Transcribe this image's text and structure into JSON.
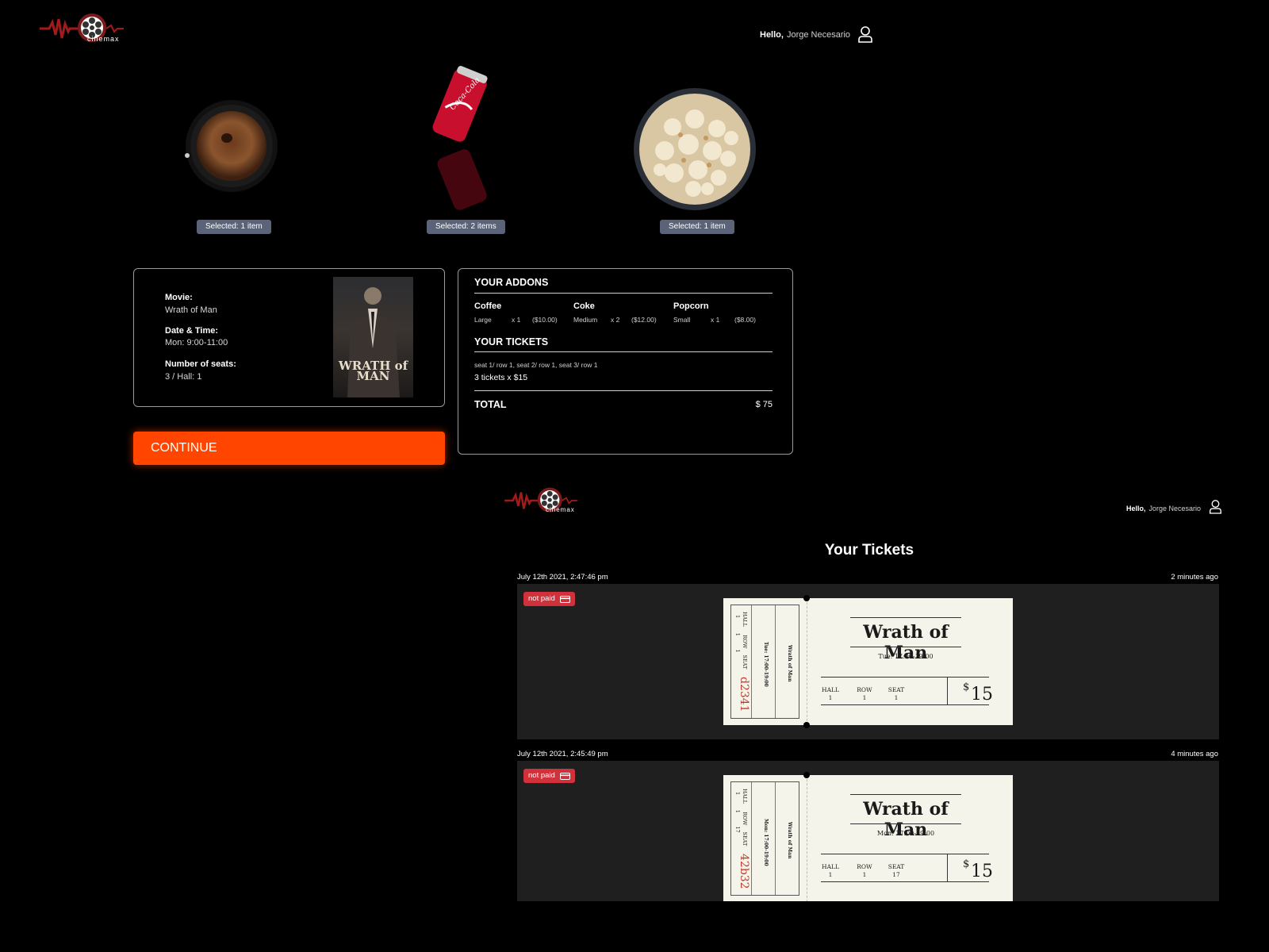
{
  "header": {
    "brand": "cinemax",
    "greeting": "Hello,",
    "user_name": "Jorge Necesario"
  },
  "addons_selection": [
    {
      "name": "Coffee",
      "icon": "coffee-cup-icon",
      "selected": "Selected: 1 item"
    },
    {
      "name": "Coke",
      "icon": "coke-can-icon",
      "selected": "Selected: 2 items"
    },
    {
      "name": "Popcorn",
      "icon": "popcorn-bowl-icon",
      "selected": "Selected: 1 item"
    }
  ],
  "booking": {
    "movie_label": "Movie:",
    "movie_value": "Wrath of Man",
    "datetime_label": "Date & Time:",
    "datetime_value": "Mon: 9:00-11:00",
    "seats_label": "Number of seats:",
    "seats_value": "3 / Hall: 1",
    "poster_title": "WRATH of MAN"
  },
  "continue_label": "CONTINUE",
  "summary": {
    "addons_heading": "YOUR ADDONS",
    "addons": [
      {
        "name": "Coffee",
        "size": "Large",
        "qty": "x 1",
        "price": "($10.00)"
      },
      {
        "name": "Coke",
        "size": "Medium",
        "qty": "x 2",
        "price": "($12.00)"
      },
      {
        "name": "Popcorn",
        "size": "Small",
        "qty": "x 1",
        "price": "($8.00)"
      }
    ],
    "tickets_heading": "YOUR TICKETS",
    "seats_line": "seat 1/ row 1, seat 2/ row 1, seat 3/ row 1",
    "tickets_line": "3 tickets x $15",
    "total_label": "TOTAL",
    "total_value": "$ 75"
  },
  "tickets_page": {
    "title": "Your Tickets",
    "tickets": [
      {
        "date": "July 12th 2021, 2:47:46 pm",
        "ago": "2 minutes ago",
        "status": "not paid",
        "movie": "Wrath of Man",
        "time": "Tue: 17:00-19:00",
        "stub_time": "Tue: 17:00-19:00",
        "hall_label": "HALL",
        "row_label": "ROW",
        "seat_label": "SEAT",
        "hall": "1",
        "row": "1",
        "seat": "1",
        "code": "d2341",
        "currency": "$",
        "price": "15"
      },
      {
        "date": "July 12th 2021, 2:45:49 pm",
        "ago": "4 minutes ago",
        "status": "not paid",
        "movie": "Wrath of Man",
        "time": "Mon: 17:00-19:00",
        "stub_time": "Mon: 17:00-19:00",
        "hall_label": "HALL",
        "row_label": "ROW",
        "seat_label": "SEAT",
        "hall": "1",
        "row": "1",
        "seat": "17",
        "code": "42b32",
        "currency": "$",
        "price": "15"
      }
    ]
  },
  "colors": {
    "accent": "#ff4500",
    "badge": "#5a6378",
    "not_paid": "#d1313a",
    "ticket_bg": "#f5f4ea",
    "code_red": "#c0392b"
  }
}
